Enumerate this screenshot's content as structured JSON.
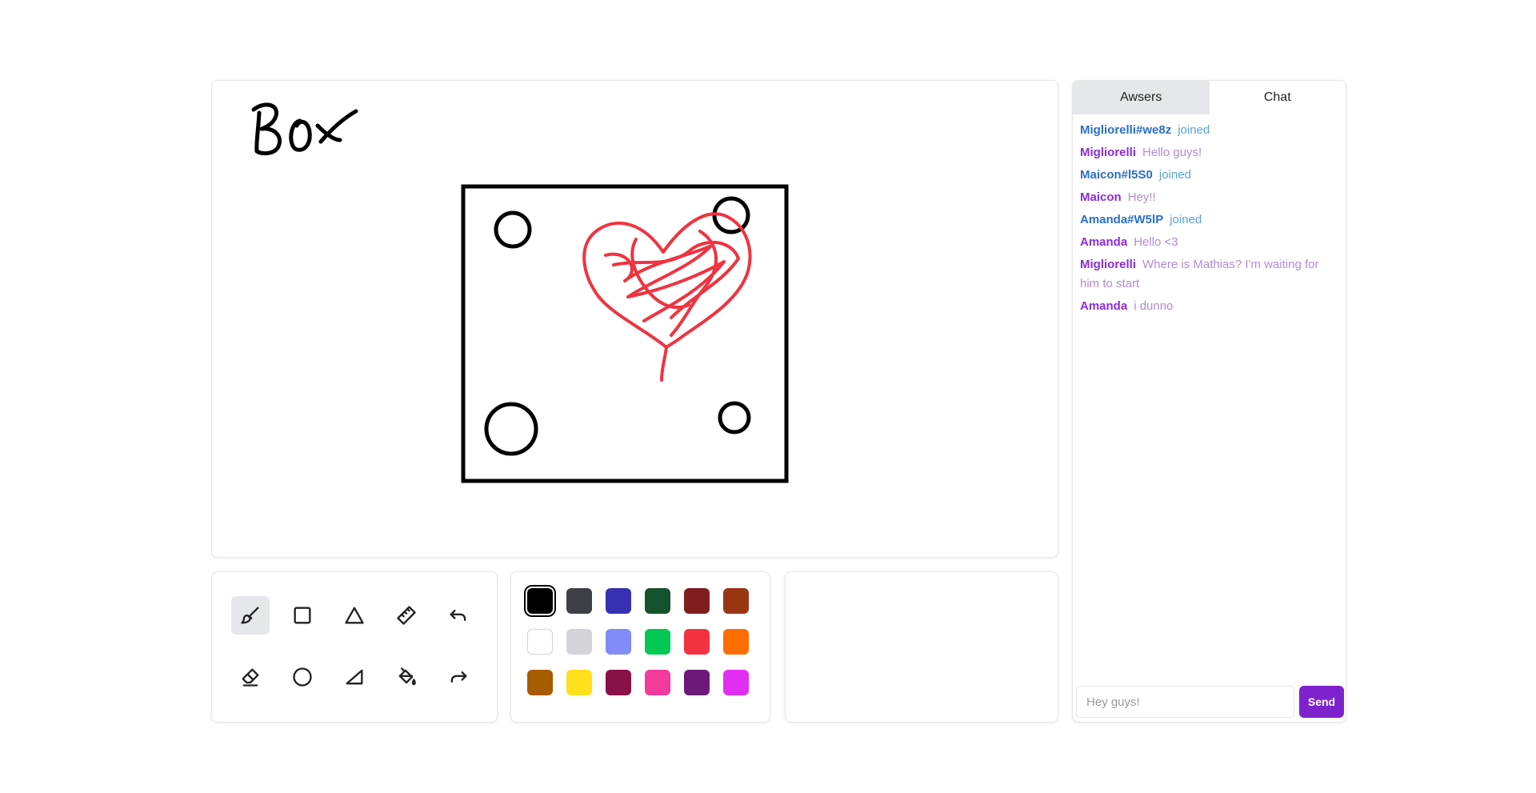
{
  "canvas": {
    "drawing_text": "Box",
    "stroke_colors": {
      "outline": "#000000",
      "heart": "#ef3340"
    }
  },
  "tools": [
    {
      "name": "brush-icon",
      "active": true
    },
    {
      "name": "rectangle-icon",
      "active": false
    },
    {
      "name": "triangle-icon",
      "active": false
    },
    {
      "name": "ruler-icon",
      "active": false
    },
    {
      "name": "undo-icon",
      "active": false
    },
    {
      "name": "eraser-icon",
      "active": false
    },
    {
      "name": "circle-icon",
      "active": false
    },
    {
      "name": "right-triangle-icon",
      "active": false
    },
    {
      "name": "fill-bucket-icon",
      "active": false
    },
    {
      "name": "redo-icon",
      "active": false
    }
  ],
  "palette": {
    "selected": "#000000",
    "colors": [
      "#000000",
      "#3f3f46",
      "#3730b3",
      "#14532d",
      "#7f1d1d",
      "#9a3412",
      "#ffffff",
      "#d4d4d8",
      "#818cf8",
      "#00c853",
      "#f23240",
      "#ff6d00",
      "#a85c00",
      "#ffe01a",
      "#881147",
      "#f23b9d",
      "#6b1a7a",
      "#e22ef2"
    ]
  },
  "chat": {
    "tabs": {
      "answers": "Awsers",
      "chat": "Chat"
    },
    "messages": [
      {
        "type": "join",
        "name": "Migliorelli#we8z",
        "text": "joined"
      },
      {
        "type": "talk",
        "name": "Migliorelli",
        "text": "Hello guys!"
      },
      {
        "type": "join",
        "name": "Maicon#l5S0",
        "text": "joined"
      },
      {
        "type": "talk",
        "name": "Maicon",
        "text": "Hey!!"
      },
      {
        "type": "join",
        "name": "Amanda#W5lP",
        "text": "joined"
      },
      {
        "type": "talk",
        "name": "Amanda",
        "text": "Hello <3"
      },
      {
        "type": "talk",
        "name": "Migliorelli",
        "text": "Where is Mathias? I'm waiting for him to start"
      },
      {
        "type": "talk",
        "name": "Amanda",
        "text": "i dunno"
      }
    ],
    "input_placeholder": "Hey guys!",
    "send_label": "Send"
  }
}
